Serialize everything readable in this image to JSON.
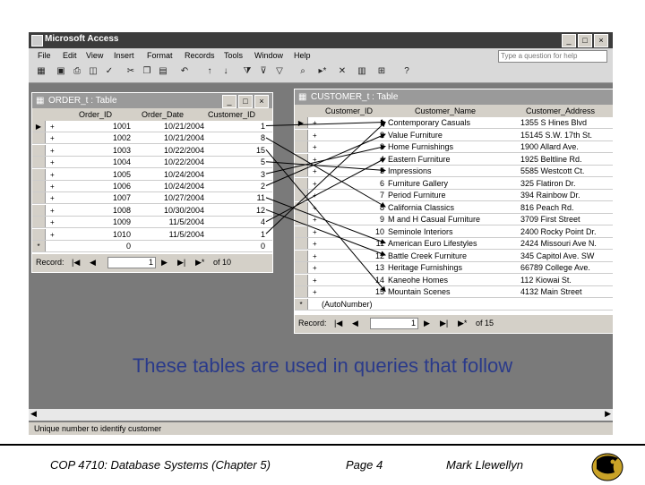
{
  "app": {
    "title": "Microsoft Access"
  },
  "menu": [
    "File",
    "Edit",
    "View",
    "Insert",
    "Format",
    "Records",
    "Tools",
    "Window",
    "Help"
  ],
  "help_placeholder": "Type a question for help",
  "order_window": {
    "title": "ORDER_t : Table",
    "columns": [
      "Order_ID",
      "Order_Date",
      "Customer_ID"
    ],
    "rows": [
      [
        "1001",
        "10/21/2004",
        "1"
      ],
      [
        "1002",
        "10/21/2004",
        "8"
      ],
      [
        "1003",
        "10/22/2004",
        "15"
      ],
      [
        "1004",
        "10/22/2004",
        "5"
      ],
      [
        "1005",
        "10/24/2004",
        "3"
      ],
      [
        "1006",
        "10/24/2004",
        "2"
      ],
      [
        "1007",
        "10/27/2004",
        "11"
      ],
      [
        "1008",
        "10/30/2004",
        "12"
      ],
      [
        "1009",
        "11/5/2004",
        "4"
      ],
      [
        "1010",
        "11/5/2004",
        "1"
      ],
      [
        "0",
        "",
        "0"
      ]
    ],
    "record_label": "Record:",
    "record_current": "1",
    "record_total": "of  10"
  },
  "customer_window": {
    "title": "CUSTOMER_t : Table",
    "columns": [
      "Customer_ID",
      "Customer_Name",
      "Customer_Address"
    ],
    "rows": [
      [
        "1",
        "Contemporary Casuals",
        "1355 S Hines Blvd"
      ],
      [
        "2",
        "Value Furniture",
        "15145 S.W. 17th St."
      ],
      [
        "3",
        "Home Furnishings",
        "1900 Allard Ave."
      ],
      [
        "4",
        "Eastern Furniture",
        "1925 Beltline Rd."
      ],
      [
        "5",
        "Impressions",
        "5585 Westcott Ct."
      ],
      [
        "6",
        "Furniture Gallery",
        "325 Flatiron Dr."
      ],
      [
        "7",
        "Period Furniture",
        "394 Rainbow Dr."
      ],
      [
        "8",
        "California Classics",
        "816 Peach Rd."
      ],
      [
        "9",
        "M and H Casual Furniture",
        "3709 First Street"
      ],
      [
        "10",
        "Seminole Interiors",
        "2400 Rocky Point Dr."
      ],
      [
        "11",
        "American Euro Lifestyles",
        "2424 Missouri Ave N."
      ],
      [
        "12",
        "Battle Creek Furniture",
        "345 Capitol Ave. SW"
      ],
      [
        "13",
        "Heritage Furnishings",
        "66789 College Ave."
      ],
      [
        "14",
        "Kaneohe Homes",
        "112 Kiowai St."
      ],
      [
        "15",
        "Mountain Scenes",
        "4132 Main Street"
      ],
      [
        "(AutoNumber)",
        "",
        ""
      ]
    ],
    "record_label": "Record:",
    "record_current": "1",
    "record_total": "of  15"
  },
  "caption": "These tables are used in queries that follow",
  "status_text": "Unique number to identify customer",
  "footer": {
    "course": "COP 4710: Database Systems  (Chapter 5)",
    "page": "Page 4",
    "author": "Mark Llewellyn"
  }
}
